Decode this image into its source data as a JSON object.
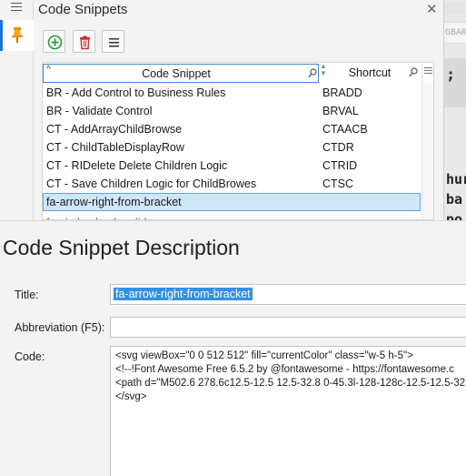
{
  "panel": {
    "title": "Code Snippets",
    "close_glyph": "✕",
    "toolbar": {
      "add_icon": "plus-circle-icon",
      "delete_icon": "trash-icon",
      "menu_icon": "hamburger-icon"
    }
  },
  "grid": {
    "columns": [
      {
        "label": "Code Snippet",
        "sort_glyph": "^"
      },
      {
        "label": "Shortcut"
      }
    ],
    "rows": [
      {
        "snippet": "BR - Add Control to Business Rules",
        "shortcut": "BRADD"
      },
      {
        "snippet": "BR - Validate Control",
        "shortcut": "BRVAL"
      },
      {
        "snippet": "CT - AddArrayChildBrowse",
        "shortcut": "CTAACB"
      },
      {
        "snippet": "CT - ChildTableDisplayRow",
        "shortcut": "CTDR"
      },
      {
        "snippet": "CT - RIDelete Delete Children Logic",
        "shortcut": "CTRID"
      },
      {
        "snippet": "CT - Save Children Logic for ChildBrowes",
        "shortcut": "CTSC"
      },
      {
        "snippet": "fa-arrow-right-from-bracket",
        "shortcut": ""
      },
      {
        "snippet": "fa-circle-check-solid",
        "shortcut": ""
      }
    ],
    "selected_index": 6
  },
  "background": {
    "tab_text": "GBAR",
    "semicolon": ";",
    "fragments": [
      "hur",
      "ba",
      "po"
    ]
  },
  "description": {
    "heading": "Code Snippet Description",
    "title_label": "Title:",
    "title_value": "fa-arrow-right-from-bracket",
    "abbr_label": "Abbreviation (F5):",
    "abbr_value": "",
    "code_label": "Code:",
    "code_lines": [
      "<svg viewBox=\"0 0 512 512\" fill=\"currentColor\" class=\"w-5 h-5\">",
      "<!--!Font Awesome Free 6.5.2 by @fontawesome - https://fontawesome.c",
      "<path d=\"M502.6 278.6c12.5-12.5 12.5-32.8 0-45.3l-128-128c-12.5-12.5-32.",
      "</svg>"
    ]
  },
  "colors": {
    "accent": "#1a73d9",
    "selection": "#cfe6fb",
    "selection_border": "#5aa6e6",
    "text_highlight": "#3390e8"
  }
}
